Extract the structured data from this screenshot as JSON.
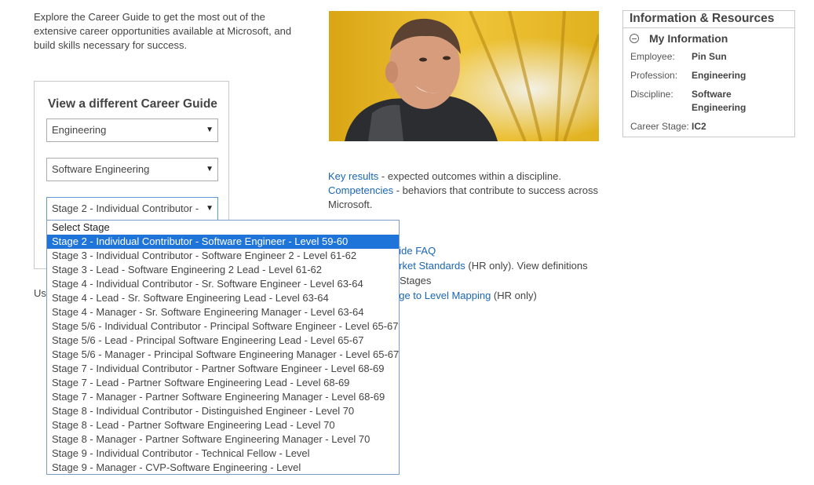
{
  "intro": "Explore the Career Guide to get the most out of the extensive career opportunities available at Microsoft, and build skills necessary for success.",
  "guide": {
    "title": "View a different Career Guide",
    "profession_select": "Engineering",
    "discipline_select": "Software Engineering",
    "stage_select": "Stage 2 - Individual Contributor -",
    "use_text": "Us"
  },
  "links": {
    "key_results": "Key results",
    "key_results_desc": " - expected outcomes within a discipline.",
    "competencies": "Competencies",
    "competencies_desc": " - behaviors that contribute to success across Microsoft.",
    "faq_frag": "uide FAQ",
    "market_frag": "arket Standards",
    "market_suffix": " (HR only). View definitions",
    "stages_frag": "r Stages",
    "mapping_frag": "age to Level Mapping",
    "mapping_suffix": " (HR only)"
  },
  "info": {
    "title": "Information & Resources",
    "my_info": "My Information",
    "employee_label": "Employee:",
    "employee": "Pin Sun",
    "profession_label": "Profession:",
    "profession": "Engineering",
    "discipline_label": "Discipline:",
    "discipline": "Software Engineering",
    "stage_label": "Career Stage:",
    "stage": "IC2"
  },
  "dropdown": {
    "selected_index": 1,
    "options": [
      "Select Stage",
      "Stage 2 - Individual Contributor - Software Engineer - Level 59-60",
      "Stage 3 - Individual Contributor - Software Engineer 2 - Level 61-62",
      "Stage 3 - Lead - Software Engineering 2 Lead - Level 61-62",
      "Stage 4 - Individual Contributor - Sr. Software Engineer - Level 63-64",
      "Stage 4 - Lead - Sr. Software Engineering Lead - Level 63-64",
      "Stage 4 - Manager - Sr. Software Engineering Manager - Level 63-64",
      "Stage 5/6 - Individual Contributor - Principal Software Engineer - Level 65-67",
      "Stage 5/6 - Lead - Principal Software Engineering Lead - Level 65-67",
      "Stage 5/6 - Manager - Principal Software Engineering Manager - Level 65-67",
      "Stage 7 - Individual Contributor - Partner Software Engineer - Level 68-69",
      "Stage 7 - Lead - Partner Software Engineering Lead - Level 68-69",
      "Stage 7 - Manager - Partner Software Engineering Manager - Level 68-69",
      "Stage 8 - Individual Contributor - Distinguished Engineer - Level 70",
      "Stage 8 - Lead - Partner Software Engineering Lead - Level 70",
      "Stage 8 - Manager - Partner Software Engineering Manager - Level 70",
      "Stage 9 - Individual Contributor - Technical Fellow - Level",
      "Stage 9 - Manager - CVP-Software Engineering - Level"
    ]
  },
  "colors": {
    "link": "#1a66b3",
    "highlight": "#1e74d8",
    "photo_bg": "#e3b51c"
  }
}
